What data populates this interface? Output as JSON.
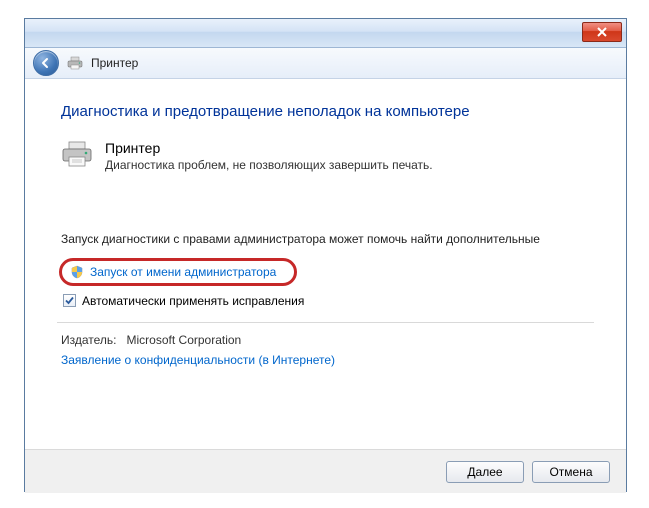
{
  "titlebar": {
    "close_tooltip": "Close"
  },
  "nav": {
    "title": "Принтер"
  },
  "main": {
    "heading": "Диагностика и предотвращение неполадок на компьютере",
    "printer": {
      "title": "Принтер",
      "description": "Диагностика проблем, не позволяющих завершить печать."
    },
    "diag_hint": "Запуск диагностики с правами администратора может помочь найти дополнительные",
    "admin_link": "Запуск от имени администратора",
    "auto_apply_label": "Автоматически применять исправления",
    "auto_apply_checked": true,
    "publisher_label": "Издатель:",
    "publisher_value": "Microsoft Corporation",
    "privacy_link": "Заявление о конфиденциальности (в Интернете)"
  },
  "footer": {
    "next": "Далее",
    "cancel": "Отмена"
  }
}
